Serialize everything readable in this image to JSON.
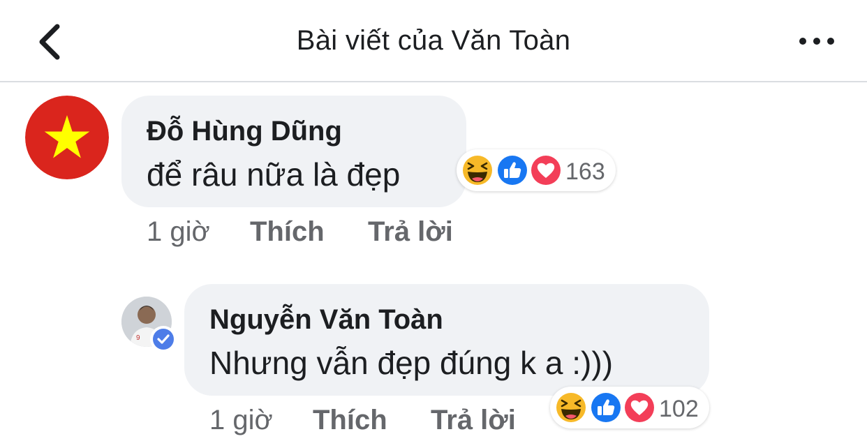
{
  "header": {
    "title": "Bài viết của Văn Toàn"
  },
  "comments": [
    {
      "author": "Đỗ Hùng Dũng",
      "text": "để râu nữa là đẹp",
      "reaction_count": "163",
      "time": "1 giờ",
      "like_label": "Thích",
      "reply_label": "Trả lời"
    },
    {
      "author": "Nguyễn Văn Toàn",
      "text": "Nhưng vẫn đẹp đúng k a :)))",
      "reaction_count": "102",
      "time": "1 giờ",
      "like_label": "Thích",
      "reply_label": "Trả lời"
    }
  ],
  "icons": {
    "back": "chevron-left-icon",
    "more": "more-horizontal-icon",
    "reactions": [
      "haha-reaction-icon",
      "like-reaction-icon",
      "love-reaction-icon"
    ],
    "verified": "verified-badge-icon"
  },
  "colors": {
    "bubble": "#f0f2f5",
    "like_blue": "#1877f2",
    "love_red": "#f33e58",
    "haha_yellow": "#f7b928",
    "flag_red": "#da251d",
    "flag_star": "#ffff00"
  }
}
